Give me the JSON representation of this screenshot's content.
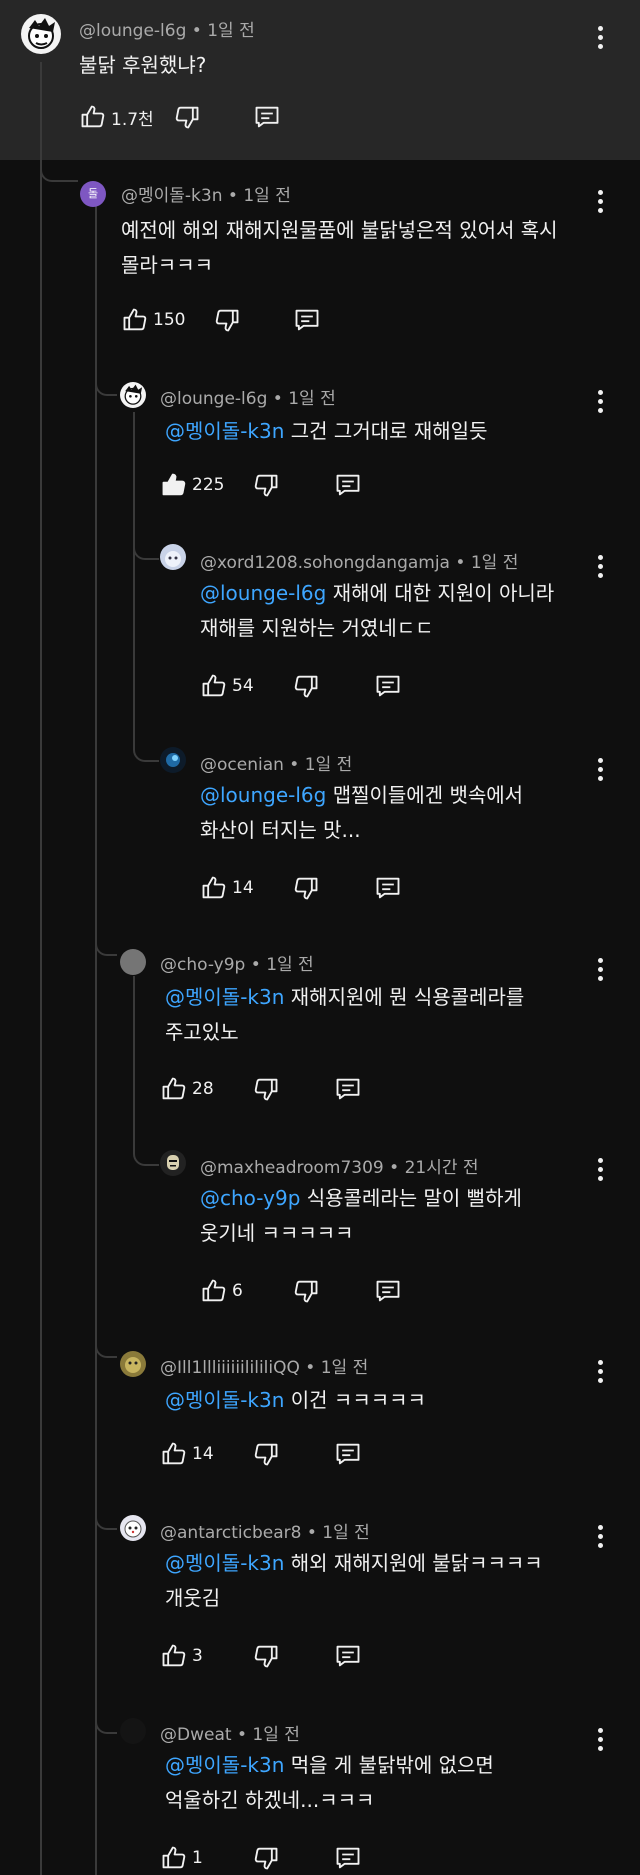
{
  "comments": [
    {
      "author": "@lounge-l6g",
      "time": "1일 전",
      "mention": "",
      "text": "불닭 후원했냐?",
      "likes": "1.7천"
    },
    {
      "author": "@멩이돌-k3n",
      "time": "1일 전",
      "mention": "",
      "text": "예전에 해외 재해지원물품에 불닭넣은적 있어서 혹시\n몰라ㅋㅋㅋ",
      "likes": "150",
      "avatar_letter": "돌"
    },
    {
      "author": "@lounge-l6g",
      "time": "1일 전",
      "mention": "@멩이돌-k3n",
      "text": " 그건 그거대로 재해일듯",
      "likes": "225"
    },
    {
      "author": "@xord1208.sohongdangamja",
      "time": "1일 전",
      "mention": "@lounge-l6g",
      "text": " 재해에 대한 지원이 아니라\n재해를 지원하는 거였네ㄷㄷ",
      "likes": "54"
    },
    {
      "author": "@ocenian",
      "time": "1일 전",
      "mention": "@lounge-l6g",
      "text": " 맵찔이들에겐 뱃속에서\n화산이 터지는 맛...",
      "likes": "14"
    },
    {
      "author": "@cho-y9p",
      "time": "1일 전",
      "mention": "@멩이돌-k3n",
      "text": " 재해지원에 뭔 식용콜레라를\n주고있노",
      "likes": "28"
    },
    {
      "author": "@maxheadroom7309",
      "time": "21시간 전",
      "mention": "@cho-y9p",
      "text": " 식용콜레라는 말이 뻘하게\n웃기네 ㅋㅋㅋㅋㅋ",
      "likes": "6"
    },
    {
      "author": "@Ill1llliiiiiilililiQQ",
      "time": "1일 전",
      "mention": "@멩이돌-k3n",
      "text": " 이건 ㅋㅋㅋㅋㅋ",
      "likes": "14"
    },
    {
      "author": "@antarcticbear8",
      "time": "1일 전",
      "mention": "@멩이돌-k3n",
      "text": " 해외 재해지원에 불닭ㅋㅋㅋㅋ\n개웃김",
      "likes": "3"
    },
    {
      "author": "@Dweat",
      "time": "1일 전",
      "mention": "@멩이돌-k3n",
      "text": " 먹을 게 불닭밖에 없으면\n억울하긴 하겠네...ㅋㅋㅋ",
      "likes": "1"
    }
  ],
  "icons": {
    "like": "thumb-up-icon",
    "dislike": "thumb-down-icon",
    "reply": "reply-icon",
    "more": "more-vert-icon"
  },
  "colors": {
    "background": "#0f0f0f",
    "highlight": "#272727",
    "mention": "#3ea6ff",
    "meta": "#aaaaaa",
    "avatar_purple": "#7e57c2"
  }
}
